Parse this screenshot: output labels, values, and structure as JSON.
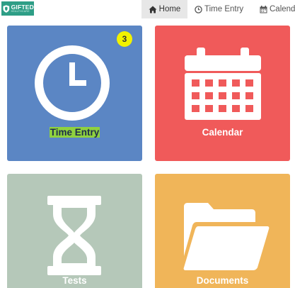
{
  "brand": {
    "name": "GIFTED",
    "tagline": "HEALTHCARE",
    "icon": "shield-icon"
  },
  "nav": [
    {
      "label": "Home",
      "icon": "home-icon",
      "active": true
    },
    {
      "label": "Time Entry",
      "icon": "clock-icon",
      "active": false
    },
    {
      "label": "Calendar",
      "icon": "calendar-icon",
      "active": false
    }
  ],
  "tiles": [
    {
      "label": "Time Entry",
      "icon": "clock-icon",
      "color": "#5b86c4",
      "badge": "3"
    },
    {
      "label": "Calendar",
      "icon": "calendar-icon",
      "color": "#f05a5a"
    },
    {
      "label": "Tests",
      "icon": "hourglass-icon",
      "color": "#b5c8b9"
    },
    {
      "label": "Documents",
      "icon": "folder-open-icon",
      "color": "#f0b559"
    }
  ],
  "colors": {
    "brand": "#2e9e86",
    "badge": "#f2f200",
    "highlight": "#8fd13f"
  }
}
